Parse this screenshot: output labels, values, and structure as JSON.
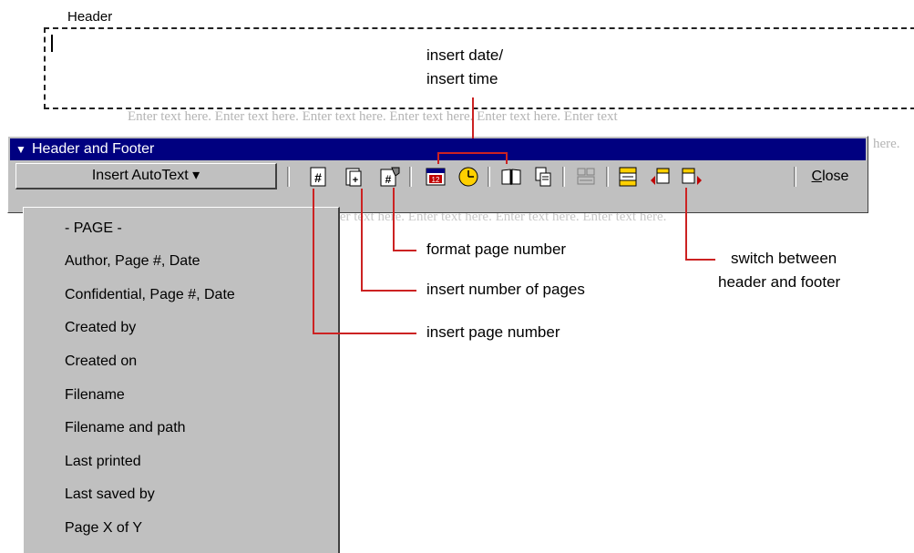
{
  "header": {
    "label": "Header",
    "filler_line_1": "Enter text here.  Enter text here.  Enter text here.  Enter text here.  Enter text here.  Enter text",
    "filler_line_2": "here.",
    "filler_line_3": "Enter text here.  Enter text here.  Enter text here.  Enter text here."
  },
  "toolbar": {
    "title": "Header and Footer",
    "autotext_label": "Insert AutoText ▾",
    "close_label": "Close",
    "buttons": [
      {
        "icon": "insert-page-number-icon"
      },
      {
        "icon": "insert-number-of-pages-icon"
      },
      {
        "icon": "format-page-number-icon"
      },
      {
        "icon": "insert-date-icon"
      },
      {
        "icon": "insert-time-icon"
      },
      {
        "icon": "page-setup-icon"
      },
      {
        "icon": "show-hide-document-text-icon"
      },
      {
        "icon": "same-as-previous-icon"
      },
      {
        "icon": "switch-header-footer-icon"
      },
      {
        "icon": "show-previous-icon"
      },
      {
        "icon": "show-next-icon"
      }
    ]
  },
  "autotext_menu": {
    "items": [
      "- PAGE -",
      "Author, Page #, Date",
      "Confidential, Page #, Date",
      "Created by",
      "Created on",
      "Filename",
      "Filename and path",
      "Last printed",
      "Last saved by",
      "Page X of Y"
    ]
  },
  "annotations": {
    "date_time_line1": "insert date/",
    "date_time_line2": "insert time",
    "format_page_number": "format page number",
    "insert_number_of_pages": "insert number of pages",
    "insert_page_number": "insert page number",
    "switch_line1": "switch between",
    "switch_line2": "header and footer"
  },
  "colors": {
    "titlebar": "#000080",
    "toolbar_face": "#c0c0c0",
    "callout_line": "#cc2222"
  }
}
